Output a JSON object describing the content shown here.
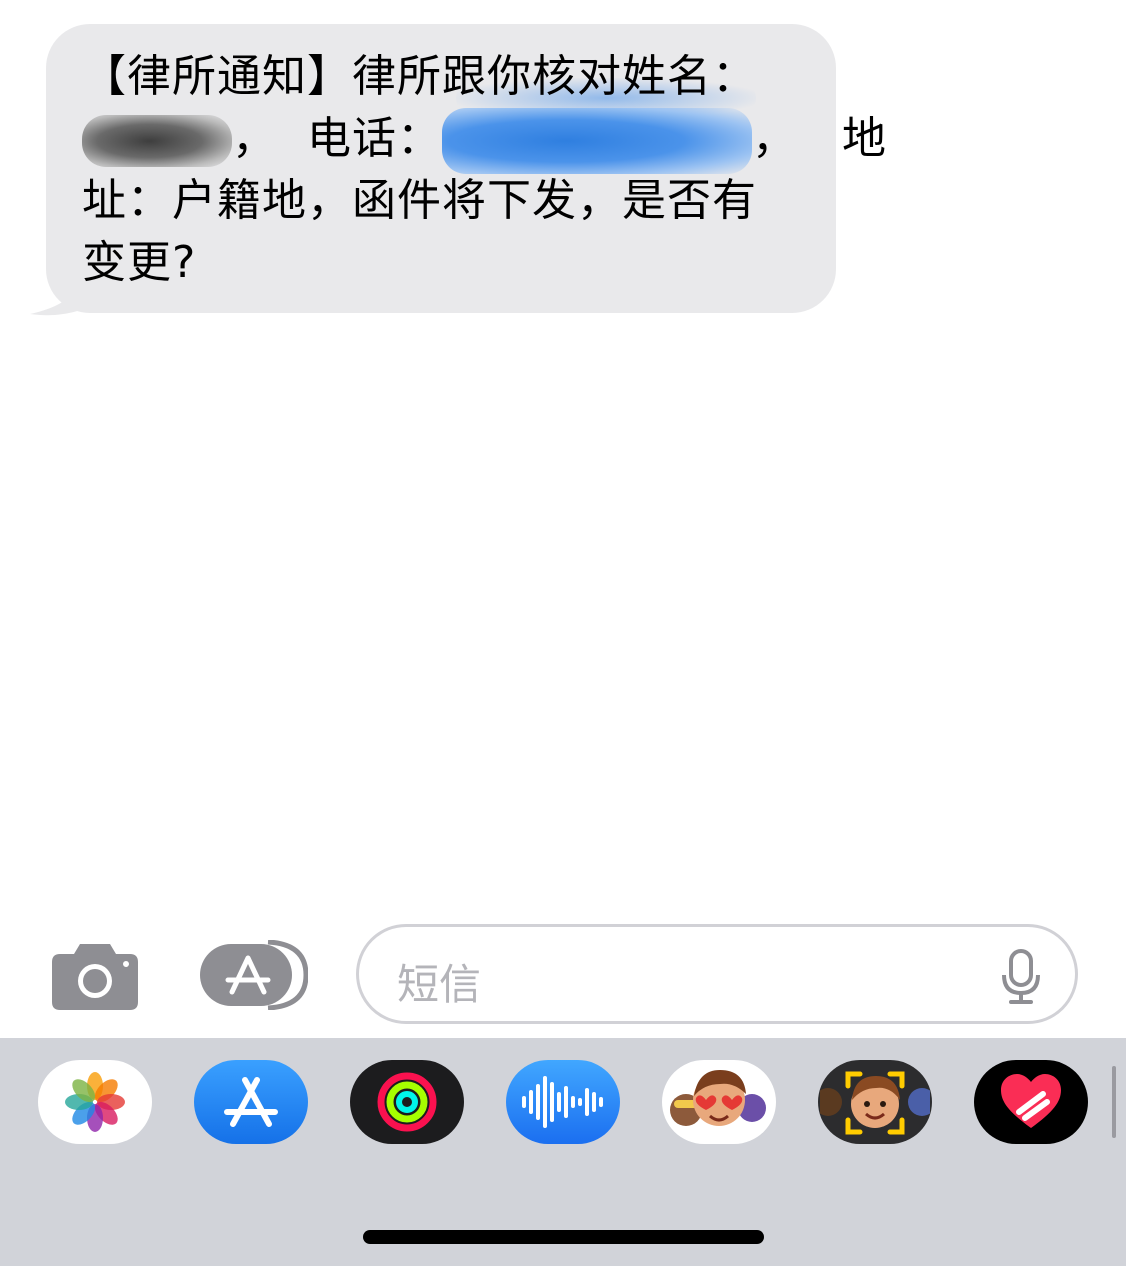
{
  "message": {
    "line1": "【律所通知】律所跟你核对姓名：",
    "line2_sep1": "，",
    "line2_label": "电话：",
    "line2_sep2": "，",
    "line2_end": "地",
    "line3": "址：户籍地，函件将下发，是否有",
    "line4": "变更?"
  },
  "composer": {
    "placeholder": "短信"
  },
  "drawer": {
    "apps": [
      {
        "icon": "photos-icon"
      },
      {
        "icon": "app-store-icon"
      },
      {
        "icon": "activity-rings-icon"
      },
      {
        "icon": "audio-waveform-icon"
      },
      {
        "icon": "memoji-stickers-icon"
      },
      {
        "icon": "memoji-camera-icon"
      },
      {
        "icon": "digital-touch-heart-icon"
      }
    ]
  },
  "colors": {
    "bubble": "#e9e9eb",
    "drawer_bg": "#d1d3d9",
    "accent_blue": "#1b6ff0",
    "placeholder": "#b4b4b9"
  }
}
